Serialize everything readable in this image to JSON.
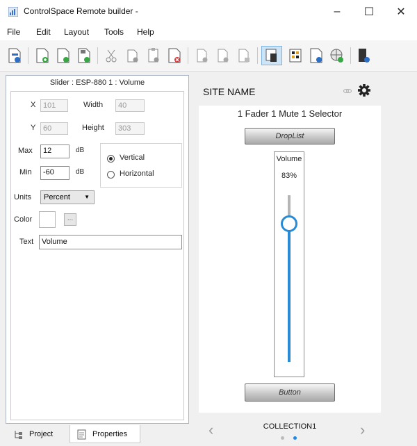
{
  "window": {
    "title": "ControlSpace Remote builder -",
    "minimize": "–",
    "maximize": "☐",
    "close": "✕"
  },
  "menu": [
    "File",
    "Edit",
    "Layout",
    "Tools",
    "Help"
  ],
  "toolbar_icons": [
    "project-properties-icon",
    "new-page-icon",
    "refresh-page-icon",
    "save-page-icon",
    "cut-icon",
    "copy-page-icon",
    "paste-page-icon",
    "delete-page-icon",
    "page-a-icon",
    "page-b-icon",
    "page-c-icon",
    "select-active-icon",
    "grid-icon",
    "page-d-icon",
    "network-icon",
    "device-icon"
  ],
  "properties": {
    "header": "Slider : ESP-880 1 : Volume",
    "x_label": "X",
    "x_value": "101",
    "width_label": "Width",
    "width_value": "40",
    "y_label": "Y",
    "y_value": "60",
    "height_label": "Height",
    "height_value": "303",
    "max_label": "Max",
    "max_value": "12",
    "max_unit": "dB",
    "min_label": "Min",
    "min_value": "-60",
    "min_unit": "dB",
    "orientation_vertical": "Vertical",
    "orientation_horizontal": "Horizontal",
    "orientation_selected": "Vertical",
    "units_label": "Units",
    "units_value": "Percent",
    "color_label": "Color",
    "color_button": "...",
    "text_label": "Text",
    "text_value": "Volume"
  },
  "tabs": {
    "project": "Project",
    "properties": "Properties",
    "active": "Properties"
  },
  "preview": {
    "site_name": "SITE NAME",
    "subtitle": "1 Fader 1 Mute 1 Selector",
    "droplist_label": "DropList",
    "slider_label": "Volume",
    "slider_value_text": "83%",
    "slider_level": 0.83,
    "button_label": "Button",
    "collection": "COLLECTION1",
    "page_dots": 2,
    "active_dot": 1,
    "prev_arrow": "‹",
    "next_arrow": "›"
  },
  "colors": {
    "accent_blue": "#1e88e5",
    "slider_track": "#2a8ad4"
  }
}
